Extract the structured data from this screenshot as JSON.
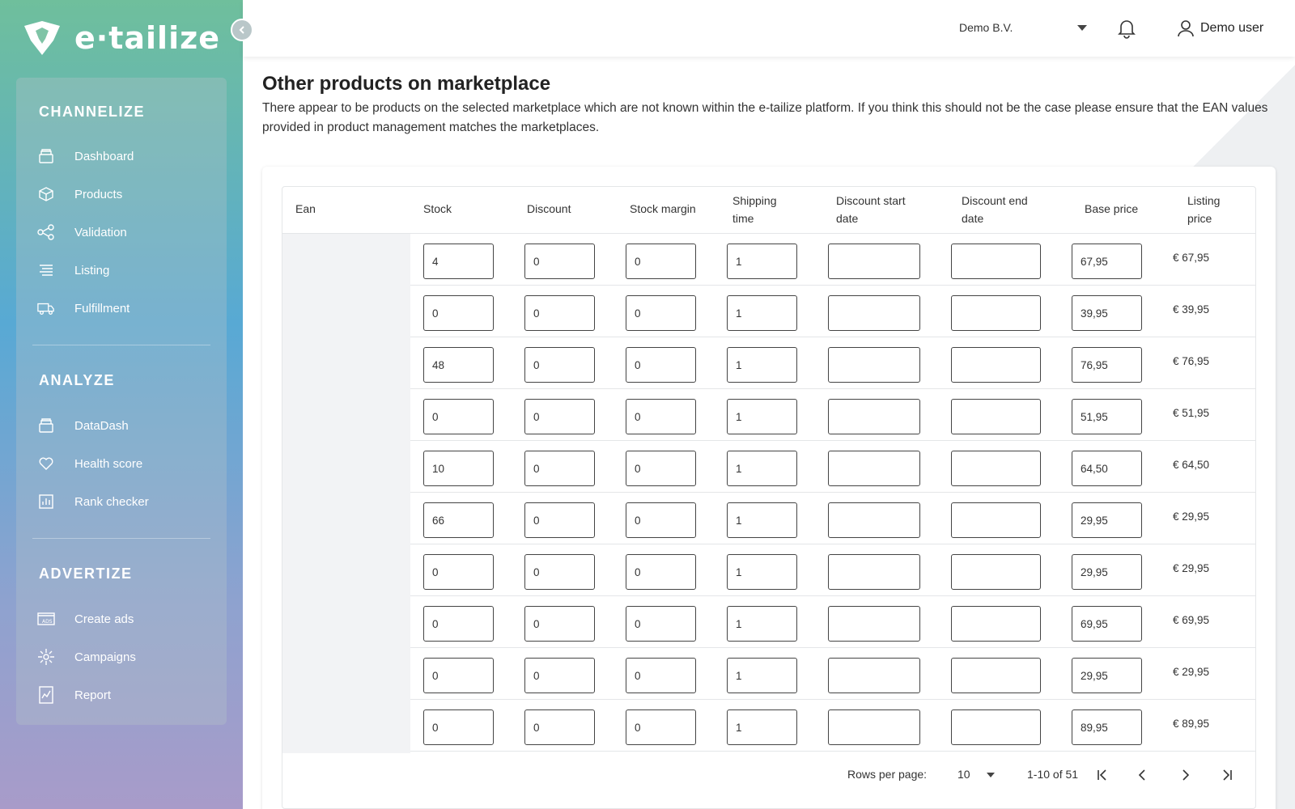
{
  "brand": {
    "name": "e·tailize"
  },
  "sidebar": {
    "sections": [
      {
        "title": "CHANNELIZE",
        "items": [
          {
            "label": "Dashboard",
            "icon": "box-icon"
          },
          {
            "label": "Products",
            "icon": "cube-icon"
          },
          {
            "label": "Validation",
            "icon": "share-nodes-icon"
          },
          {
            "label": "Listing",
            "icon": "list-lines-icon"
          },
          {
            "label": "Fulfillment",
            "icon": "truck-icon"
          }
        ]
      },
      {
        "title": "ANALYZE",
        "items": [
          {
            "label": "DataDash",
            "icon": "box-icon"
          },
          {
            "label": "Health score",
            "icon": "heart-icon"
          },
          {
            "label": "Rank checker",
            "icon": "bar-chart-icon"
          }
        ]
      },
      {
        "title": "ADVERTIZE",
        "items": [
          {
            "label": "Create ads",
            "icon": "ad-icon"
          },
          {
            "label": "Campaigns",
            "icon": "sparkle-icon"
          },
          {
            "label": "Report",
            "icon": "report-icon"
          }
        ]
      }
    ]
  },
  "header": {
    "company": "Demo B.V.",
    "user": "Demo user"
  },
  "page": {
    "title": "Other products on marketplace",
    "description": "There appear to be products on the selected marketplace which are not known within the e-tailize platform. If you think this should not be the case please ensure that the EAN values provided in product management matches the marketplaces."
  },
  "table": {
    "columns": {
      "ean": "Ean",
      "stock": "Stock",
      "discount": "Discount",
      "stock_margin": "Stock margin",
      "shipping_1": "Shipping",
      "shipping_2": "time",
      "dstart_1": "Discount start",
      "dstart_2": "date",
      "dend_1": "Discount end",
      "dend_2": "date",
      "base_price": "Base price",
      "listing_1": "Listing",
      "listing_2": "price"
    },
    "rows": [
      {
        "stock": "4",
        "discount": "0",
        "stock_margin": "0",
        "shipping": "1",
        "discount_start": "",
        "discount_end": "",
        "base_price": "67,95",
        "listing_price": "€ 67,95"
      },
      {
        "stock": "0",
        "discount": "0",
        "stock_margin": "0",
        "shipping": "1",
        "discount_start": "",
        "discount_end": "",
        "base_price": "39,95",
        "listing_price": "€ 39,95"
      },
      {
        "stock": "48",
        "discount": "0",
        "stock_margin": "0",
        "shipping": "1",
        "discount_start": "",
        "discount_end": "",
        "base_price": "76,95",
        "listing_price": "€ 76,95"
      },
      {
        "stock": "0",
        "discount": "0",
        "stock_margin": "0",
        "shipping": "1",
        "discount_start": "",
        "discount_end": "",
        "base_price": "51,95",
        "listing_price": "€ 51,95"
      },
      {
        "stock": "10",
        "discount": "0",
        "stock_margin": "0",
        "shipping": "1",
        "discount_start": "",
        "discount_end": "",
        "base_price": "64,50",
        "listing_price": "€ 64,50"
      },
      {
        "stock": "66",
        "discount": "0",
        "stock_margin": "0",
        "shipping": "1",
        "discount_start": "",
        "discount_end": "",
        "base_price": "29,95",
        "listing_price": "€ 29,95"
      },
      {
        "stock": "0",
        "discount": "0",
        "stock_margin": "0",
        "shipping": "1",
        "discount_start": "",
        "discount_end": "",
        "base_price": "29,95",
        "listing_price": "€ 29,95"
      },
      {
        "stock": "0",
        "discount": "0",
        "stock_margin": "0",
        "shipping": "1",
        "discount_start": "",
        "discount_end": "",
        "base_price": "69,95",
        "listing_price": "€ 69,95"
      },
      {
        "stock": "0",
        "discount": "0",
        "stock_margin": "0",
        "shipping": "1",
        "discount_start": "",
        "discount_end": "",
        "base_price": "29,95",
        "listing_price": "€ 29,95"
      },
      {
        "stock": "0",
        "discount": "0",
        "stock_margin": "0",
        "shipping": "1",
        "discount_start": "",
        "discount_end": "",
        "base_price": "89,95",
        "listing_price": "€ 89,95"
      }
    ],
    "pagination": {
      "rows_per_page_label": "Rows per page:",
      "rows_per_page": "10",
      "range": "1-10 of 51"
    }
  }
}
